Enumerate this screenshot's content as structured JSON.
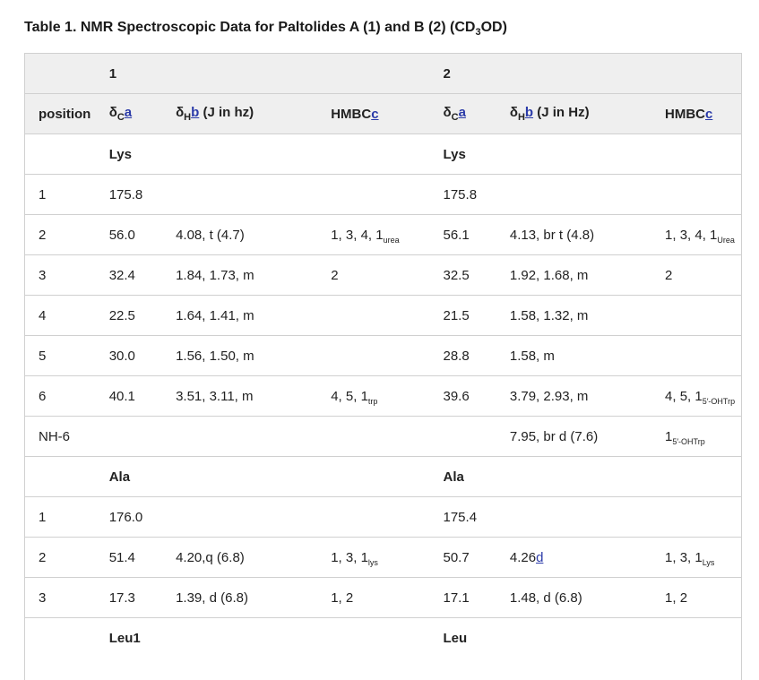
{
  "caption": {
    "prefix": "Table 1. NMR Spectroscopic Data for Paltolides A (1) and B (2) (CD",
    "sub": "3",
    "suffix": "OD)"
  },
  "header": {
    "compound1": "1",
    "compound2": "2",
    "position": "position",
    "delta_c_sym": "δ",
    "delta_c_sub": "C",
    "delta_c_fn": "a",
    "delta_h_sym": "δ",
    "delta_h_sub": "H",
    "delta_h_fn": "b",
    "j_label_1": " (J in hz)",
    "j_label_2": " (J in Hz)",
    "hmbc": "HMBC",
    "hmbc_fn": "c"
  },
  "rows": [
    {
      "type": "section",
      "c1": "Lys",
      "c2": "Lys"
    },
    {
      "pos": "1",
      "dc1": "175.8",
      "dh1": "",
      "hm1": "",
      "hm1s": "",
      "dc2": "175.8",
      "dh2": "",
      "dh2fn": "",
      "hm2": "",
      "hm2s": ""
    },
    {
      "pos": "2",
      "dc1": "56.0",
      "dh1": "4.08, t (4.7)",
      "hm1": "1, 3, 4, 1",
      "hm1s": "urea",
      "dc2": "56.1",
      "dh2": "4.13, br t (4.8)",
      "dh2fn": "",
      "hm2": "1, 3, 4, 1",
      "hm2s": "Urea"
    },
    {
      "pos": "3",
      "dc1": "32.4",
      "dh1": "1.84, 1.73, m",
      "hm1": "2",
      "hm1s": "",
      "dc2": "32.5",
      "dh2": "1.92, 1.68, m",
      "dh2fn": "",
      "hm2": "2",
      "hm2s": ""
    },
    {
      "pos": "4",
      "dc1": "22.5",
      "dh1": "1.64, 1.41, m",
      "hm1": "",
      "hm1s": "",
      "dc2": "21.5",
      "dh2": "1.58, 1.32, m",
      "dh2fn": "",
      "hm2": "",
      "hm2s": ""
    },
    {
      "pos": "5",
      "dc1": "30.0",
      "dh1": "1.56, 1.50, m",
      "hm1": "",
      "hm1s": "",
      "dc2": "28.8",
      "dh2": "1.58, m",
      "dh2fn": "",
      "hm2": "",
      "hm2s": ""
    },
    {
      "pos": "6",
      "dc1": "40.1",
      "dh1": "3.51, 3.11, m",
      "hm1": "4, 5, 1",
      "hm1s": "trp",
      "dc2": "39.6",
      "dh2": "3.79, 2.93, m",
      "dh2fn": "",
      "hm2": "4, 5, 1",
      "hm2s": "5′-OHTrp"
    },
    {
      "pos": "NH-6",
      "dc1": "",
      "dh1": "",
      "hm1": "",
      "hm1s": "",
      "dc2": "",
      "dh2": "7.95, br d (7.6)",
      "dh2fn": "",
      "hm2": "1",
      "hm2s": "5′-OHTrp"
    },
    {
      "type": "section",
      "c1": "Ala",
      "c2": "Ala"
    },
    {
      "pos": "1",
      "dc1": "176.0",
      "dh1": "",
      "hm1": "",
      "hm1s": "",
      "dc2": "175.4",
      "dh2": "",
      "dh2fn": "",
      "hm2": "",
      "hm2s": ""
    },
    {
      "pos": "2",
      "dc1": "51.4",
      "dh1": "4.20,q (6.8)",
      "hm1": "1, 3, 1",
      "hm1s": "lys",
      "dc2": "50.7",
      "dh2": "4.26",
      "dh2fn": "d",
      "hm2": "1, 3, 1",
      "hm2s": "Lys"
    },
    {
      "pos": "3",
      "dc1": "17.3",
      "dh1": "1.39, d (6.8)",
      "hm1": "1, 2",
      "hm1s": "",
      "dc2": "17.1",
      "dh2": "1.48, d (6.8)",
      "dh2fn": "",
      "hm2": "1, 2",
      "hm2s": ""
    },
    {
      "type": "section",
      "c1": "Leu1",
      "c2": "Leu"
    }
  ]
}
